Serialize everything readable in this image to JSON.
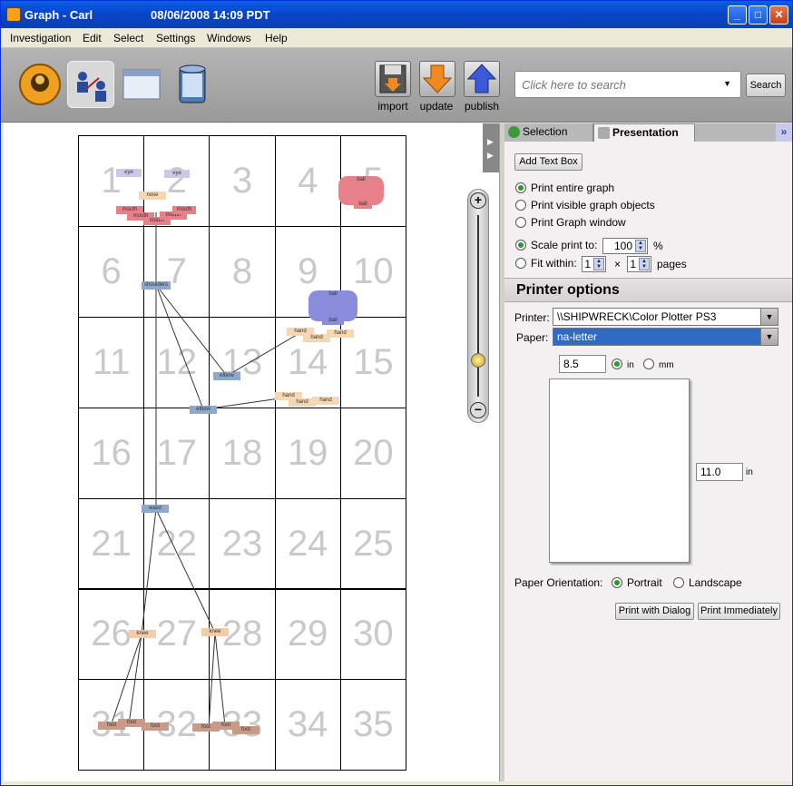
{
  "window": {
    "title": "Graph - Carl",
    "datetime": "08/06/2008 14:09 PDT",
    "controls": {
      "minimize": "_",
      "maximize": "□",
      "close": "✕"
    }
  },
  "menu": [
    "Investigation",
    "Edit",
    "Select",
    "Settings",
    "Windows",
    "Help"
  ],
  "toolbar": {
    "import_label": "import",
    "update_label": "update",
    "publish_label": "publish",
    "search_placeholder": "Click here to search",
    "search_button": "Search",
    "dropdown_arrow": "▼"
  },
  "graph": {
    "cells": [
      "1",
      "2",
      "3",
      "4",
      "5",
      "6",
      "7",
      "8",
      "9",
      "10",
      "11",
      "12",
      "13",
      "14",
      "15",
      "16",
      "17",
      "18",
      "19",
      "20",
      "21",
      "22",
      "23",
      "24",
      "25",
      "26",
      "27",
      "28",
      "29",
      "30",
      "31",
      "32",
      "33",
      "34",
      "35"
    ],
    "node_labels": {
      "eye": "eye",
      "nose": "nose",
      "mouth": "mouth",
      "ball": "ball",
      "shoulders": "shoulders",
      "elbow": "elbow",
      "hand": "hand",
      "waist": "waist",
      "knee": "knee",
      "foot": "foot"
    }
  },
  "zoom": {
    "in": "+",
    "out": "−"
  },
  "panel": {
    "tabs": [
      {
        "label": "Selection",
        "active": false
      },
      {
        "label": "Presentation",
        "active": true
      }
    ],
    "tab_more": "»",
    "add_text_box": "Add Text Box",
    "print_options": [
      {
        "label": "Print entire graph",
        "checked": true
      },
      {
        "label": "Print visible graph objects",
        "checked": false
      },
      {
        "label": "Print Graph window",
        "checked": false
      }
    ],
    "scale_label": "Scale print to:",
    "scale_value": "100",
    "scale_unit": "%",
    "fit_label": "Fit within:",
    "fit_w": "1",
    "fit_x": "×",
    "fit_h": "1",
    "fit_unit": "pages",
    "printer_options_title": "Printer options",
    "printer_label": "Printer:",
    "printer_value": "\\\\SHIPWRECK\\Color Plotter PS3",
    "paper_label": "Paper:",
    "paper_value": "na-letter",
    "width_value": "8.5",
    "unit_in": "in",
    "unit_mm": "mm",
    "height_value": "11.0",
    "height_unit": "in",
    "orientation_label": "Paper Orientation:",
    "portrait": "Portrait",
    "landscape": "Landscape",
    "print_dialog": "Print with Dialog",
    "print_now": "Print Immediately"
  },
  "colors": {
    "accent": "#316ac5",
    "title_blue": "#0a5ee8",
    "radio_green": "#2a9a2a"
  }
}
